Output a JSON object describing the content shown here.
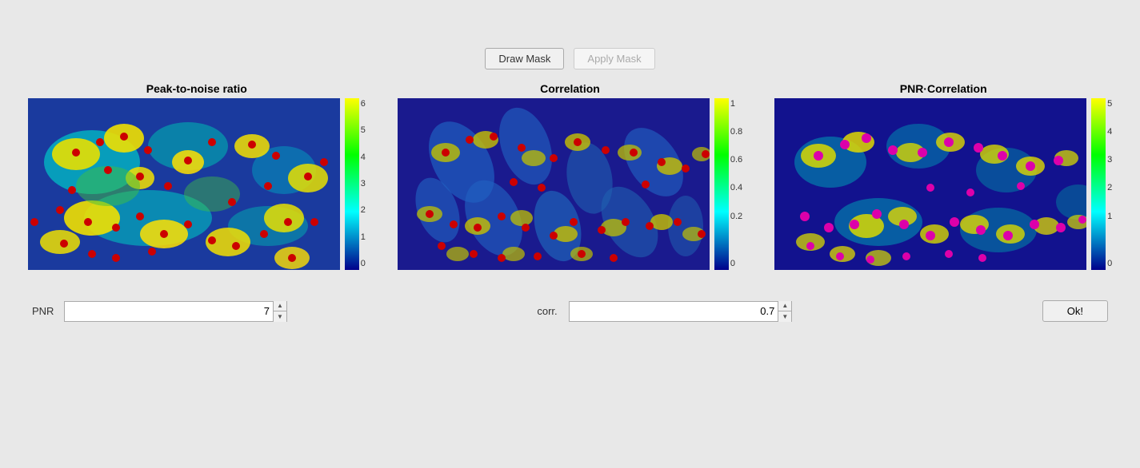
{
  "buttons": {
    "draw_mask": "Draw Mask",
    "apply_mask": "Apply Mask",
    "ok": "Ok!"
  },
  "charts": [
    {
      "id": "pnr",
      "title": "Peak-to-noise ratio",
      "colorbar_max": 6,
      "colorbar_ticks": [
        "6",
        "5",
        "4",
        "3",
        "2",
        "1",
        "0"
      ]
    },
    {
      "id": "correlation",
      "title": "Correlation",
      "colorbar_max": 1,
      "colorbar_ticks": [
        "1",
        "0.8",
        "0.6",
        "0.4",
        "0.2",
        "0"
      ]
    },
    {
      "id": "pnr_correlation",
      "title": "PNR·Correlation",
      "colorbar_max": 5,
      "colorbar_ticks": [
        "5",
        "4",
        "3",
        "2",
        "1",
        "0"
      ]
    }
  ],
  "controls": {
    "pnr_label": "PNR",
    "pnr_value": "7",
    "corr_label": "corr.",
    "corr_value": "0.7"
  }
}
